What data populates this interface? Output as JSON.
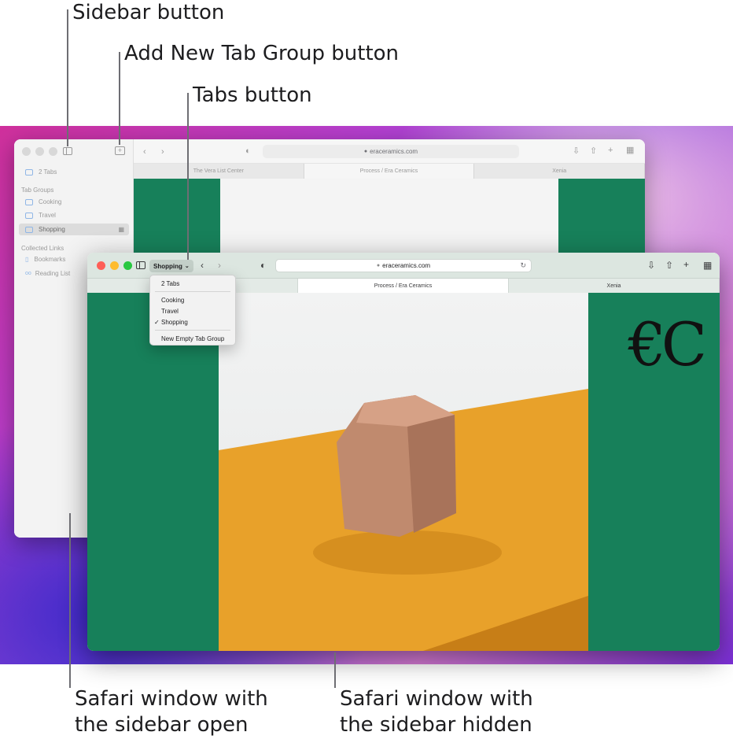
{
  "callouts": {
    "sidebar_button": "Sidebar button",
    "add_tab_group": "Add New Tab Group button",
    "tabs_button": "Tabs button",
    "sidebar_open_line1": "Safari window with",
    "sidebar_open_line2": "the sidebar open",
    "sidebar_hidden_line1": "Safari window with",
    "sidebar_hidden_line2": "the sidebar hidden"
  },
  "back_window": {
    "sidebar": {
      "tabs_count": "2 Tabs",
      "tab_groups_heading": "Tab Groups",
      "groups": [
        "Cooking",
        "Travel",
        "Shopping"
      ],
      "selected_group": "Shopping",
      "collected_links_heading": "Collected Links",
      "links": [
        "Bookmarks",
        "Reading List"
      ]
    },
    "address": "eraceramics.com",
    "tabs": [
      "The Vera List Center",
      "Process / Era Ceramics",
      "Xenia"
    ]
  },
  "front_window": {
    "tab_group_button": "Shopping",
    "address": "eraceramics.com",
    "tabs": [
      "",
      "Process / Era Ceramics",
      "Xenia"
    ],
    "logo": "€C"
  },
  "menu": {
    "tabs_count": "2 Tabs",
    "groups": [
      "Cooking",
      "Travel",
      "Shopping"
    ],
    "checked": "Shopping",
    "new_group": "New Empty Tab Group"
  },
  "icons": {
    "sidebar": "sidebar-icon",
    "add_group": "plus-square-icon",
    "back": "chevron-left-icon",
    "forward": "chevron-right-icon",
    "privacy": "shield-icon",
    "reload": "reload-icon",
    "download": "download-icon",
    "share": "share-icon",
    "new_tab": "plus-icon",
    "overview": "grid-icon"
  },
  "colors": {
    "page_green": "#17805a",
    "shelf_orange": "#e8a12a",
    "clay": "#c08a6e"
  }
}
